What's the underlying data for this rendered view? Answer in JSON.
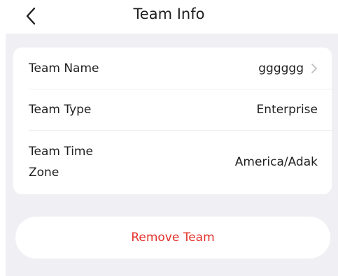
{
  "header": {
    "title": "Team Info",
    "back_icon": "chevron-left-icon"
  },
  "team_info": {
    "name": {
      "label": "Team Name",
      "value": "gggggg",
      "chevron_icon": "chevron-right-icon"
    },
    "type": {
      "label": "Team Type",
      "value": "Enterprise"
    },
    "time_zone": {
      "label_line1": "Team Time",
      "label_line2": "Zone",
      "value": "America/Adak"
    }
  },
  "actions": {
    "remove_label": "Remove Team"
  },
  "colors": {
    "page_background": "#f0f0f4",
    "card_background": "#ffffff",
    "danger": "#e4322b",
    "chevron": "#bdbdbd"
  }
}
